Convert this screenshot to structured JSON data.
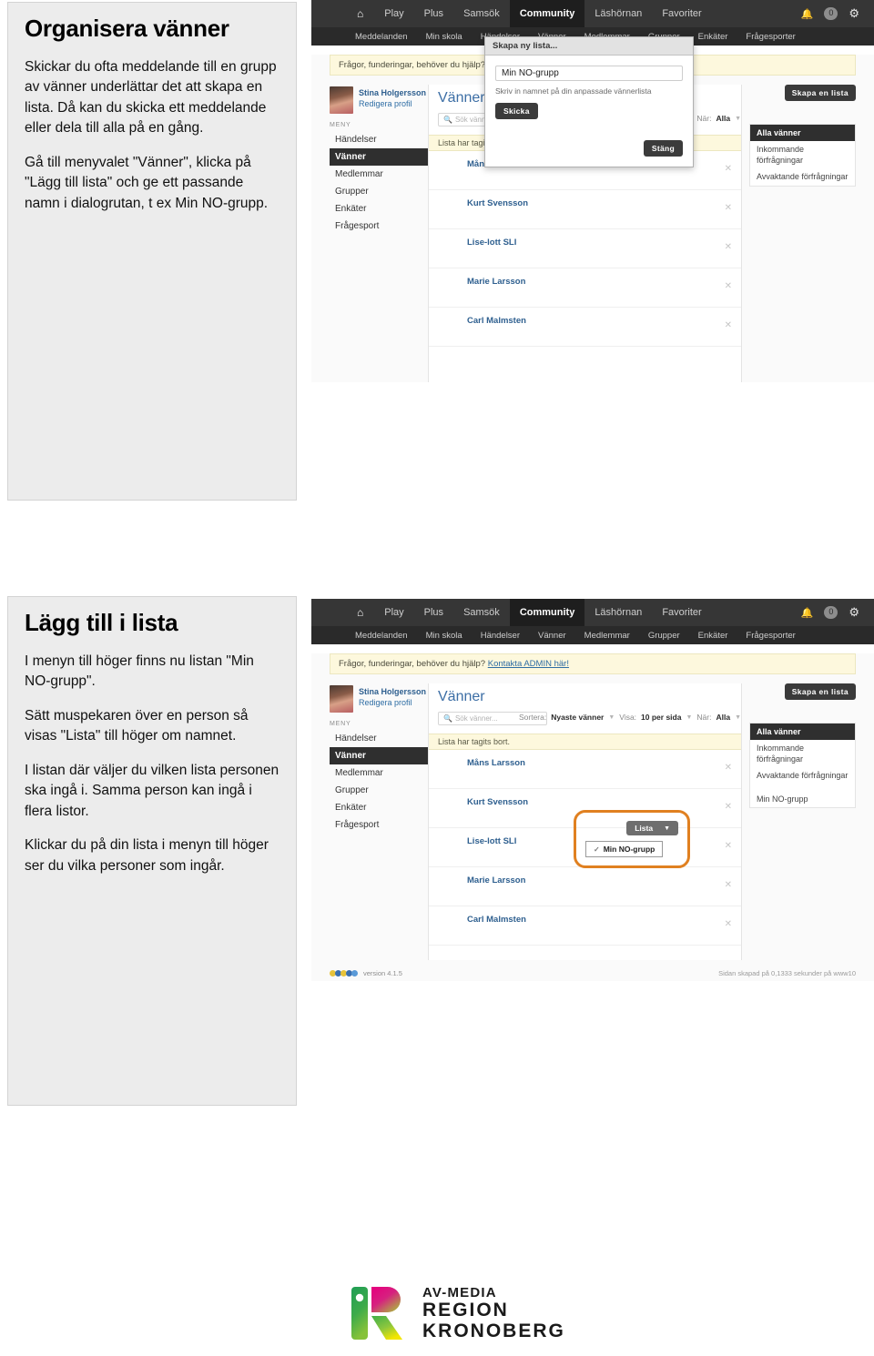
{
  "sections": [
    {
      "heading": "Organisera vänner",
      "paragraphs": [
        "Skickar du ofta meddelande till en grupp av vänner underlättar det att skapa en lista. Då kan du skicka ett meddelande eller dela till alla på en gång.",
        "Gå till menyvalet \"Vänner\", klicka på \"Lägg till lista\" och ge ett passande namn i dialogrutan, t ex Min NO-grupp."
      ]
    },
    {
      "heading": "Lägg till i lista",
      "paragraphs": [
        "I menyn till höger finns nu listan \"Min NO-grupp\".",
        "Sätt muspekaren över en person så visas \"Lista\" till höger om namnet.",
        "I listan där väljer du vilken lista personen ska ingå i. Samma person kan ingå i flera listor.",
        "Klickar du på din lista i menyn till höger ser du vilka personer som ingår."
      ]
    }
  ],
  "app": {
    "nav": {
      "home_icon": "home-icon",
      "items": [
        "Play",
        "Plus",
        "Samsök",
        "Community",
        "Läshörnan",
        "Favoriter"
      ],
      "active": "Community",
      "bell_icon": "bell-icon",
      "notification_count": "0",
      "gear_icon": "gear-icon"
    },
    "subnav": {
      "items": [
        "Meddelanden",
        "Min skola",
        "Händelser",
        "Vänner",
        "Medlemmar",
        "Grupper",
        "Enkäter",
        "Frågesporter"
      ]
    },
    "helpbar": {
      "text": "Frågor, funderingar, behöver du hjälp?",
      "link": "Kontakta ADMIN här!"
    },
    "sidebar": {
      "profile_name": "Stina Holgersson",
      "profile_link": "Redigera profil",
      "menu_label": "MENY",
      "items": [
        "Händelser",
        "Vänner",
        "Medlemmar",
        "Grupper",
        "Enkäter",
        "Frågesport"
      ],
      "active": "Vänner"
    },
    "main": {
      "title": "Vänner",
      "search_placeholder": "Sök vänner...",
      "search_icon": "search-icon",
      "notice": "Lista har tagits bort.",
      "create_list_button": "Skapa en lista",
      "toolbar": {
        "sort_label": "Sortera:",
        "sort_value": "Nyaste vänner",
        "show_label": "Visa:",
        "show_value": "10 per sida",
        "when_label": "När:",
        "when_value": "Alla"
      },
      "friends": [
        {
          "name": "Måns Larsson",
          "avatar_class": "a2"
        },
        {
          "name": "Kurt Svensson",
          "avatar_class": "a3"
        },
        {
          "name": "Lise-lott SLI",
          "avatar_class": "a4"
        },
        {
          "name": "Marie Larsson",
          "avatar_class": "a5"
        },
        {
          "name": "Carl Malmsten",
          "avatar_class": "a6"
        }
      ],
      "remove_icon": "close-icon"
    },
    "right_panel_1": [
      "Alla vänner",
      "Inkommande förfrågningar",
      "Avvaktande förfrågningar"
    ],
    "right_panel_2": [
      "Alla vänner",
      "Inkommande förfrågningar",
      "Avvaktande förfrågningar",
      "Min NO-grupp"
    ],
    "right_panel_active": "Alla vänner",
    "modal": {
      "title": "Skapa ny lista...",
      "input_value": "Min NO-grupp",
      "hint": "Skriv in namnet på din anpassade vännerlista",
      "submit": "Skicka",
      "close": "Stäng"
    },
    "list_dropdown": {
      "button": "Lista",
      "caret_icon": "chevron-down-icon",
      "check_icon": "check-icon",
      "option": "Min NO-grupp"
    },
    "footer": {
      "brand": "SLI",
      "version": "version 4.1.5",
      "right": "Sidan skapad på 0,1333 sekunder på www10"
    }
  },
  "logo": {
    "line1": "AV-MEDIA",
    "line2": "REGION",
    "line3": "KRONOBERG",
    "mark": "region-kronoberg-logo"
  }
}
